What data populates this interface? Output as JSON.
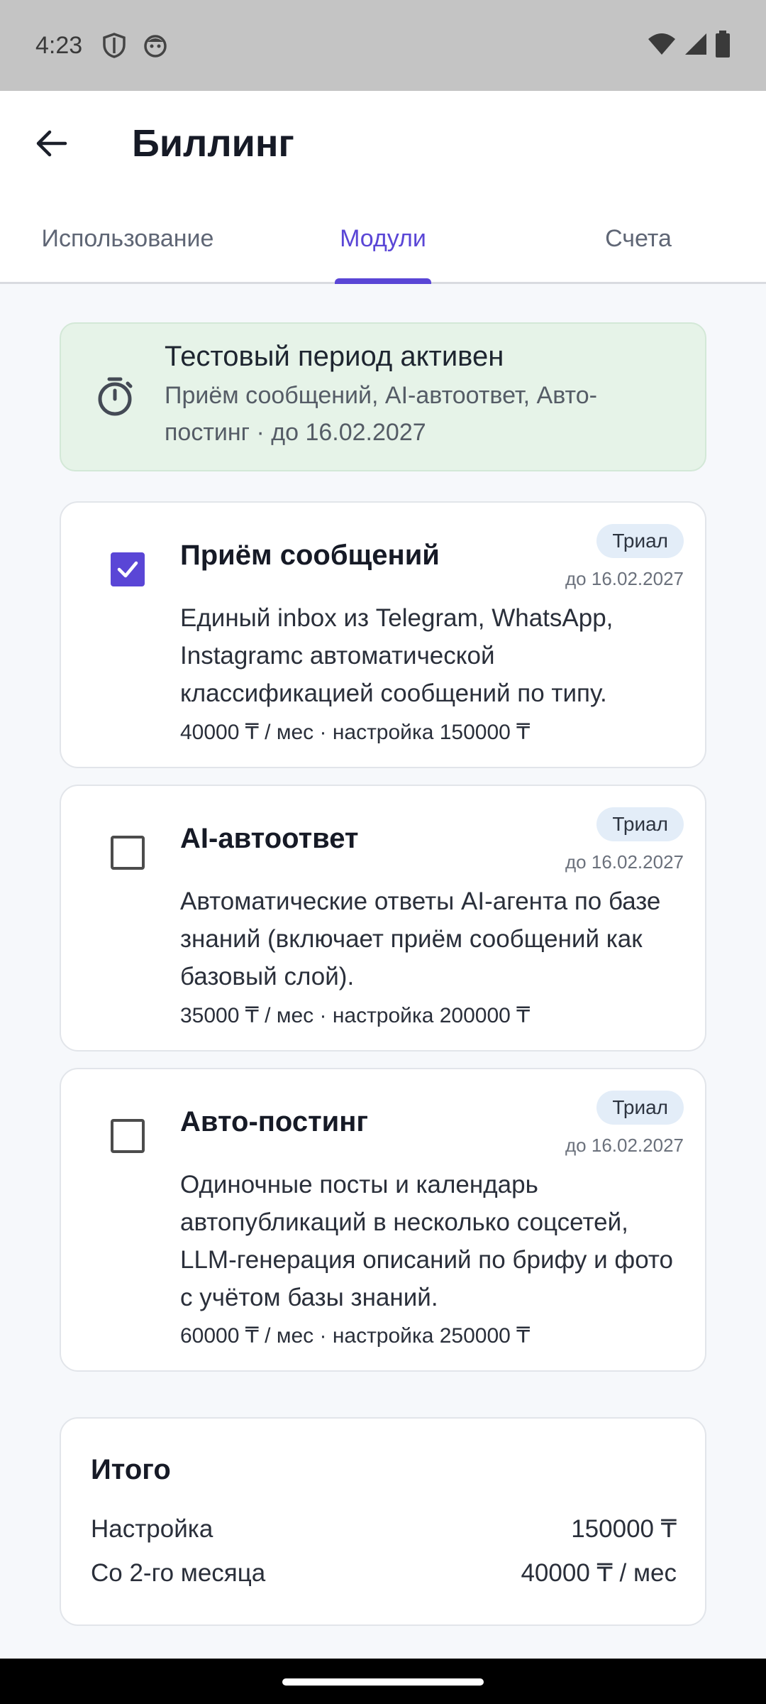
{
  "status_bar": {
    "time": "4:23",
    "icons": [
      "shield-icon",
      "face-icon"
    ],
    "right_icons": [
      "wifi-icon",
      "signal-icon",
      "battery-icon"
    ]
  },
  "app_bar": {
    "back_icon": "arrow-left-icon",
    "title": "Биллинг"
  },
  "tabs": [
    {
      "label": "Использование",
      "active": false
    },
    {
      "label": "Модули",
      "active": true
    },
    {
      "label": "Счета",
      "active": false
    }
  ],
  "trial_banner": {
    "icon": "timer-icon",
    "title": "Тестовый период активен",
    "subtitle": "Приём сообщений, AI-автоответ, Авто-постинг · до 16.02.2027"
  },
  "modules": [
    {
      "title": "Приём сообщений",
      "checked": true,
      "badge": "Триал",
      "badge_date": "до 16.02.2027",
      "description": "Единый inbox из Telegram, WhatsApp, Instagramс автоматической классификацией сообщений по типу.",
      "price": "40000 ₸ / мес · настройка 150000 ₸"
    },
    {
      "title": "AI-автоответ",
      "checked": false,
      "badge": "Триал",
      "badge_date": "до 16.02.2027",
      "description": "Автоматические ответы AI-агента по базе знаний (включает приём сообщений как базовый слой).",
      "price": "35000 ₸ / мес · настройка 200000 ₸"
    },
    {
      "title": "Авто-постинг",
      "checked": false,
      "badge": "Триал",
      "badge_date": "до 16.02.2027",
      "description": "Одиночные посты и календарь автопубликаций в несколько соцсетей, LLM-генерация описаний по брифу и фото с учётом базы знаний.",
      "price": "60000 ₸ / мес · настройка 250000 ₸"
    }
  ],
  "summary": {
    "title": "Итого",
    "rows": [
      {
        "label": "Настройка",
        "value": "150000 ₸"
      },
      {
        "label": "Со 2-го месяца",
        "value": "40000 ₸ / мес"
      }
    ]
  },
  "colors": {
    "accent": "#5a46d6",
    "trial_banner_bg": "#e6f3e8",
    "badge_bg": "#e3edf8",
    "page_bg": "#f6f8fb"
  }
}
